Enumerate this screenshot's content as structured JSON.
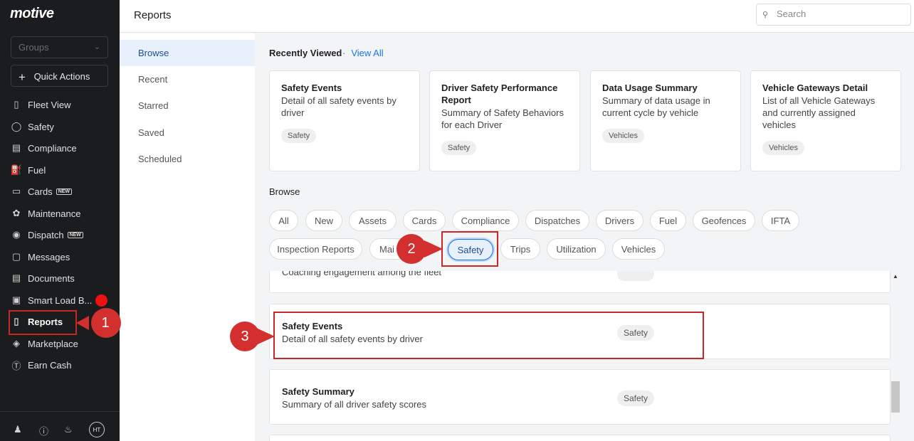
{
  "sidebar": {
    "logo": "motive",
    "groups_placeholder": "Groups",
    "quick_actions": "Quick Actions",
    "items": [
      {
        "label": "Fleet View",
        "icon": "map-icon"
      },
      {
        "label": "Safety",
        "icon": "shield-icon"
      },
      {
        "label": "Compliance",
        "icon": "document-icon"
      },
      {
        "label": "Fuel",
        "icon": "fuel-icon"
      },
      {
        "label": "Cards",
        "icon": "card-icon",
        "badge": "NEW"
      },
      {
        "label": "Maintenance",
        "icon": "wrench-icon"
      },
      {
        "label": "Dispatch",
        "icon": "location-icon",
        "badge": "NEW"
      },
      {
        "label": "Messages",
        "icon": "chat-icon"
      },
      {
        "label": "Documents",
        "icon": "file-icon"
      },
      {
        "label": "Smart Load B...",
        "icon": "truck-icon"
      },
      {
        "label": "Reports",
        "icon": "chart-icon",
        "active": true
      },
      {
        "label": "Marketplace",
        "icon": "layers-icon"
      },
      {
        "label": "Earn Cash",
        "icon": "dollar-icon"
      }
    ],
    "avatar_initials": "HT"
  },
  "header": {
    "title": "Reports",
    "search_placeholder": "Search"
  },
  "subnav": {
    "items": [
      "Browse",
      "Recent",
      "Starred",
      "Saved",
      "Scheduled"
    ],
    "active": "Browse"
  },
  "recent": {
    "heading": "Recently Viewed",
    "view_all": "View All",
    "cards": [
      {
        "title": "Safety Events",
        "desc": "Detail of all safety events by driver",
        "tag": "Safety"
      },
      {
        "title": "Driver Safety Performance Report",
        "desc": "Summary of Safety Behaviors for each Driver",
        "tag": "Safety"
      },
      {
        "title": "Data Usage Summary",
        "desc": "Summary of data usage in current cycle by vehicle",
        "tag": "Vehicles"
      },
      {
        "title": "Vehicle Gateways Detail",
        "desc": "List of all Vehicle Gateways and currently assigned vehicles",
        "tag": "Vehicles"
      }
    ]
  },
  "browse": {
    "heading": "Browse",
    "chips": [
      "All",
      "New",
      "Assets",
      "Cards",
      "Compliance",
      "Dispatches",
      "Drivers",
      "Fuel",
      "Geofences",
      "IFTA",
      "Inspection Reports",
      "Mai",
      "Safety",
      "Trips",
      "Utilization",
      "Vehicles"
    ],
    "selected": "Safety"
  },
  "report_list": [
    {
      "title": "",
      "desc": "Coaching engagement among the fleet",
      "tag": ""
    },
    {
      "title": "Safety Events",
      "desc": "Detail of all safety events by driver",
      "tag": "Safety"
    },
    {
      "title": "Safety Summary",
      "desc": "Summary of all driver safety scores",
      "tag": "Safety"
    }
  ],
  "annotations": [
    "1",
    "2",
    "3"
  ],
  "colors": {
    "sidebar_bg": "#1b1c1e",
    "accent_blue": "#1a73e8",
    "annotation_red": "#c62828"
  }
}
